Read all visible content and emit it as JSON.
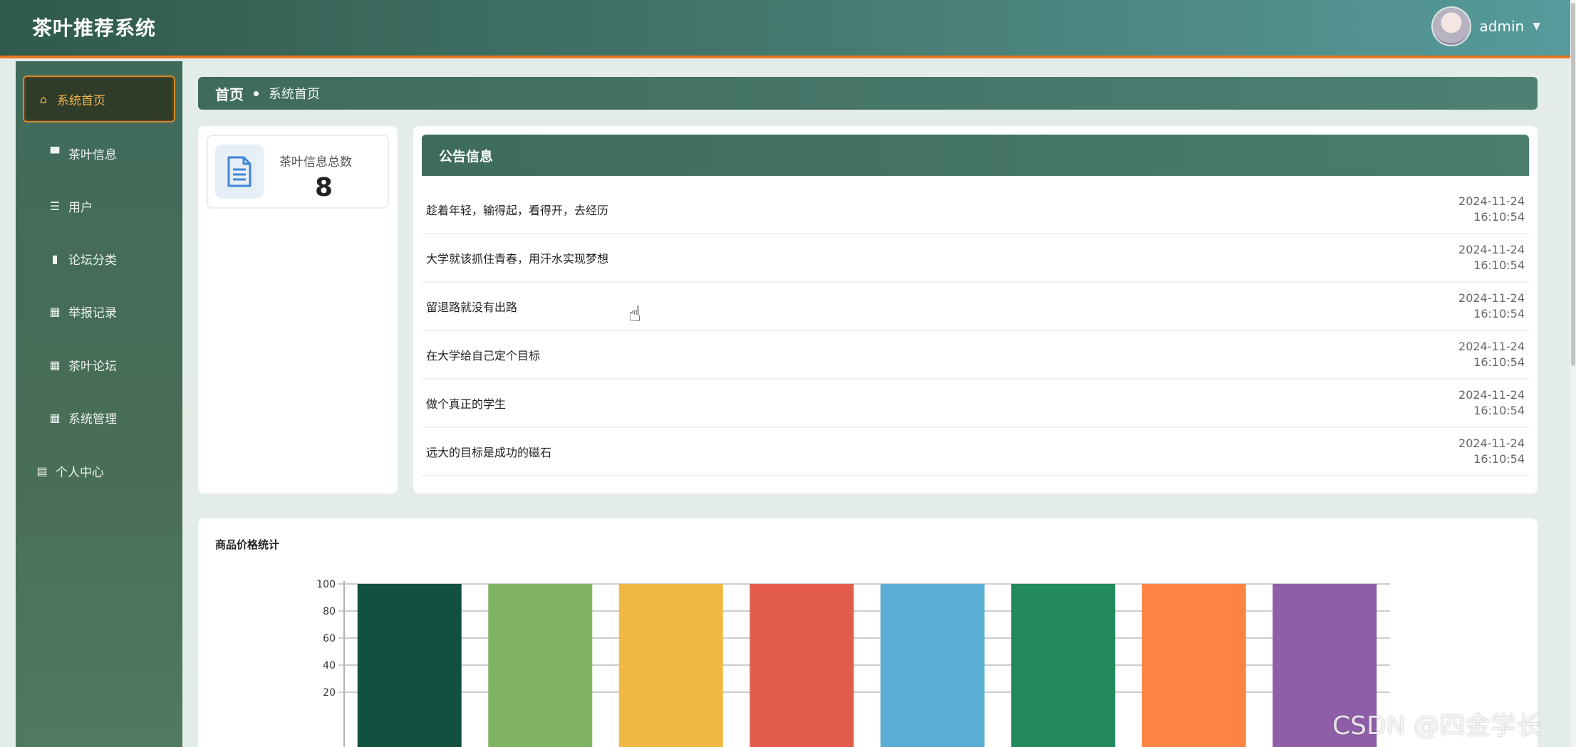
{
  "app": {
    "title": "茶叶推荐系统",
    "username": "admin"
  },
  "sidebar": {
    "items": [
      {
        "label": "系统首页",
        "icon": "home-icon",
        "active": true
      },
      {
        "label": "茶叶信息",
        "icon": "monitor-icon"
      },
      {
        "label": "用户",
        "icon": "sliders-icon"
      },
      {
        "label": "论坛分类",
        "icon": "book-icon"
      },
      {
        "label": "举报记录",
        "icon": "grid-icon"
      },
      {
        "label": "茶叶论坛",
        "icon": "grid-icon"
      },
      {
        "label": "系统管理",
        "icon": "grid-icon"
      },
      {
        "label": "个人中心",
        "icon": "calendar-icon"
      }
    ]
  },
  "breadcrumb": {
    "home": "首页",
    "current": "系统首页"
  },
  "stats": {
    "label": "茶叶信息总数",
    "value": "8"
  },
  "notice": {
    "title": "公告信息",
    "items": [
      {
        "title": "趁着年轻，输得起，看得开，去经历",
        "date": "2024-11-24",
        "time": "16:10:54"
      },
      {
        "title": "大学就该抓住青春，用汗水实现梦想",
        "date": "2024-11-24",
        "time": "16:10:54"
      },
      {
        "title": "留退路就没有出路",
        "date": "2024-11-24",
        "time": "16:10:54"
      },
      {
        "title": "在大学给自己定个目标",
        "date": "2024-11-24",
        "time": "16:10:54"
      },
      {
        "title": "做个真正的学生",
        "date": "2024-11-24",
        "time": "16:10:54"
      },
      {
        "title": "远大的目标是成功的磁石",
        "date": "2024-11-24",
        "time": "16:10:54"
      }
    ]
  },
  "chart_data": {
    "type": "bar",
    "title": "商品价格统计",
    "categories": [
      "",
      "",
      "",
      "",
      "",
      "",
      "",
      ""
    ],
    "values": [
      100,
      100,
      100,
      100,
      100,
      100,
      100,
      100
    ],
    "colors": [
      "#12513f",
      "#80b462",
      "#f0b944",
      "#e45d4c",
      "#5aaed6",
      "#228a5e",
      "#fd8343",
      "#8f5ea8"
    ],
    "y_ticks": [
      100,
      80,
      60,
      40,
      20
    ],
    "ylim": [
      0,
      100
    ],
    "grid": true
  },
  "watermark": "CSDN @四金学长"
}
